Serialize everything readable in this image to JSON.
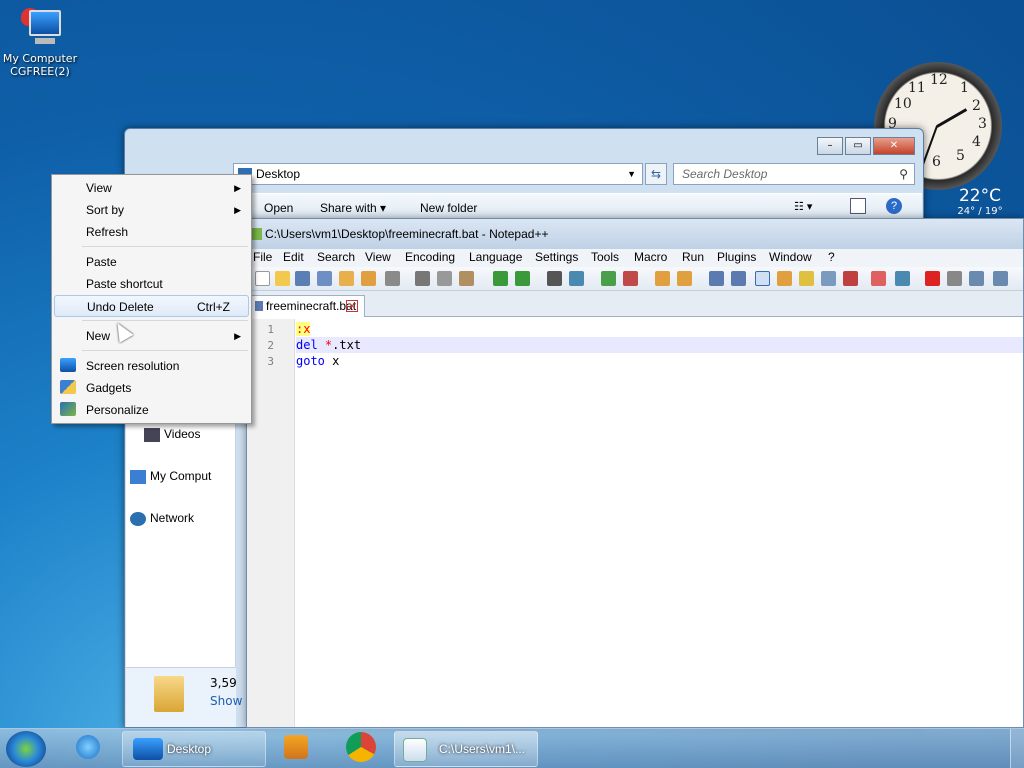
{
  "desktop": {
    "icon_label_line1": "My Computer",
    "icon_label_line2": "CGFREE(2)"
  },
  "clock": {
    "numbers": [
      "12",
      "1",
      "2",
      "3",
      "4",
      "5",
      "6",
      "7",
      "8",
      "9",
      "10",
      "11"
    ]
  },
  "weather": {
    "temp": "22°C",
    "range": "24° / 19°"
  },
  "explorer": {
    "address": "Desktop",
    "search_placeholder": "Search Desktop",
    "toolbar": {
      "open": "Open",
      "share_with": "Share with",
      "new_folder": "New folder"
    },
    "nav": {
      "videos": "Videos",
      "my_computer": "My Comput",
      "network": "Network"
    },
    "status": {
      "count": "3,59",
      "show": "Show"
    }
  },
  "notepad": {
    "title": "C:\\Users\\vm1\\Desktop\\freeminecraft.bat - Notepad++",
    "menu": [
      "File",
      "Edit",
      "Search",
      "View",
      "Encoding",
      "Language",
      "Settings",
      "Tools",
      "Macro",
      "Run",
      "Plugins",
      "Window",
      "?"
    ],
    "tab": "freeminecraft.bat",
    "line_numbers": [
      "1",
      "2",
      "3"
    ],
    "code": {
      "line1": ":x",
      "line2_kw": "del",
      "line2_op": "*",
      "line2_rest": ".txt",
      "line3_kw": "goto",
      "line3_rest": "x"
    }
  },
  "context_menu": {
    "view": "View",
    "sort_by": "Sort by",
    "refresh": "Refresh",
    "paste": "Paste",
    "paste_shortcut": "Paste shortcut",
    "undo_delete": "Undo Delete",
    "undo_shortcut": "Ctrl+Z",
    "new": "New",
    "screen_resolution": "Screen resolution",
    "gadgets": "Gadgets",
    "personalize": "Personalize"
  },
  "taskbar": {
    "desktop_label": "Desktop",
    "notepad_label": "C:\\Users\\vm1\\..."
  }
}
